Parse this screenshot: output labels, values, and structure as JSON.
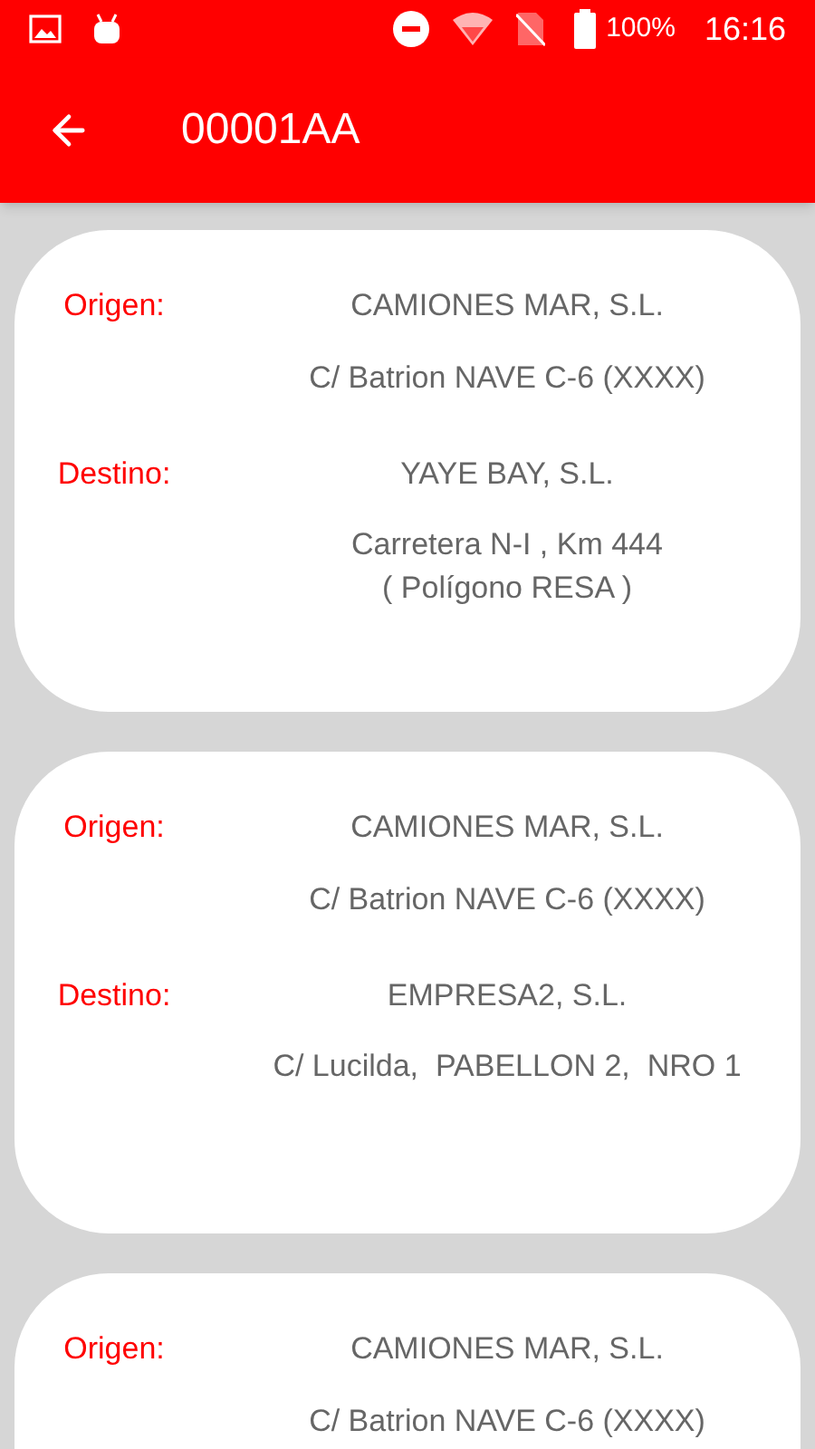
{
  "status_bar": {
    "battery": "100%",
    "time": "16:16"
  },
  "app_bar": {
    "title": "00001AA"
  },
  "cards": [
    {
      "origin_label": "Origen:",
      "origin_name": "CAMIONES MAR, S.L.",
      "origin_address": "C/ Batrion NAVE C-6 (XXXX)",
      "destination_label": "Destino:",
      "destination_name": "YAYE BAY, S.L.",
      "destination_address": "Carretera N-I , Km 444\n( Polígono RESA )"
    },
    {
      "origin_label": "Origen:",
      "origin_name": "CAMIONES MAR, S.L.",
      "origin_address": "C/ Batrion NAVE C-6 (XXXX)",
      "destination_label": "Destino:",
      "destination_name": "EMPRESA2, S.L.",
      "destination_address": "C/ Lucilda,  PABELLON 2,  NRO 1"
    },
    {
      "origin_label": "Origen:",
      "origin_name": "CAMIONES MAR, S.L.",
      "origin_address": "C/ Batrion NAVE C-6 (XXXX)"
    }
  ]
}
